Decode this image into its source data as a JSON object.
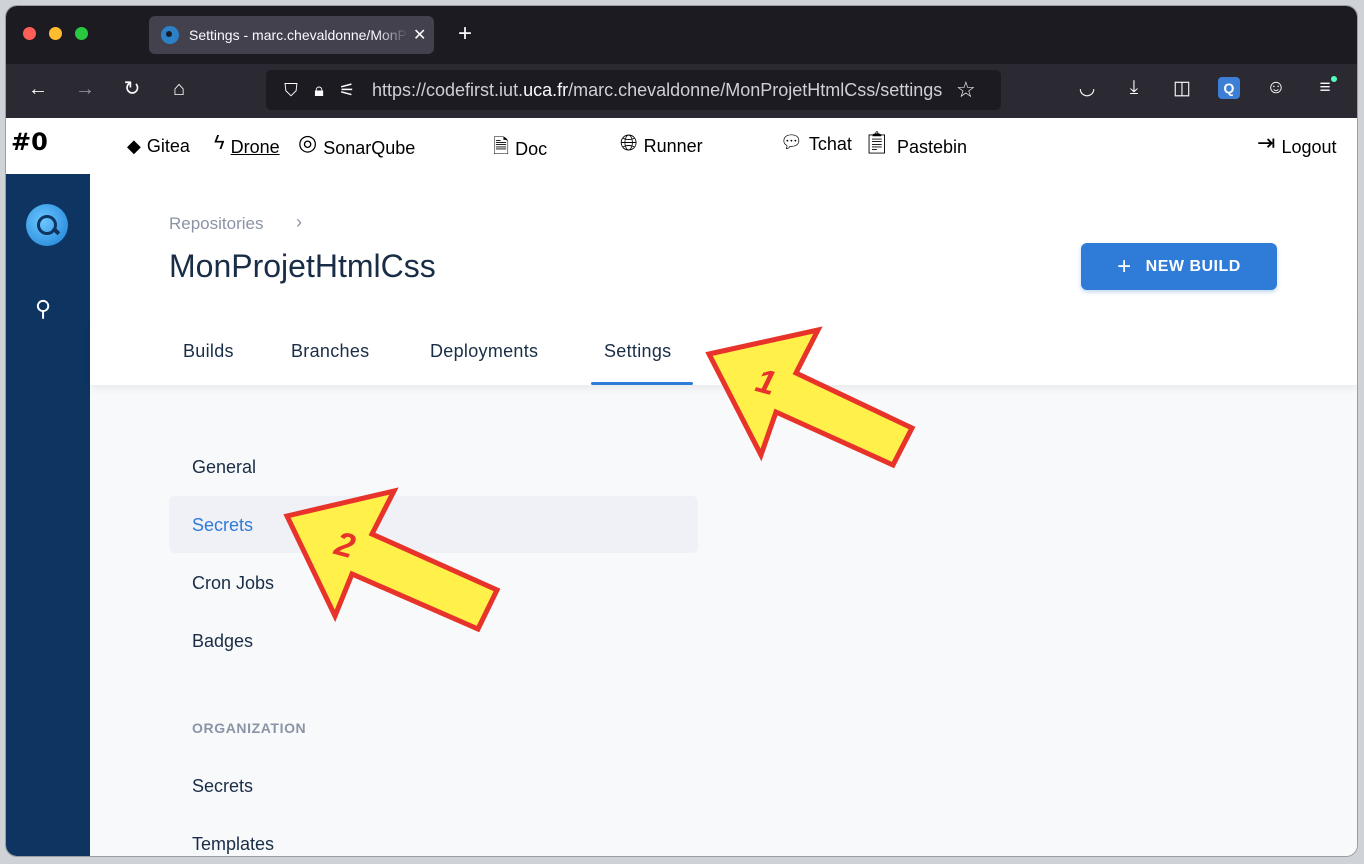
{
  "browser": {
    "tab_title": "Settings - marc.chevaldonne/MonProjetHtmlCss",
    "url_prefix": "https://codefirst.iut.",
    "url_domain": "uca.fr",
    "url_suffix": "/marc.chevaldonne/MonProjetHtmlCss/settings"
  },
  "site_header": {
    "logo": "#0",
    "links": [
      {
        "label": "Gitea",
        "icon": "git-icon"
      },
      {
        "label": "Drone",
        "icon": "lightning-icon"
      },
      {
        "label": "SonarQube",
        "icon": "sonarqube-icon"
      },
      {
        "label": "Doc",
        "icon": "doc-edit-icon"
      },
      {
        "label": "Runner",
        "icon": "globe-gear-icon"
      },
      {
        "label": "Tchat",
        "icon": "chat-icon"
      },
      {
        "label": "Pastebin",
        "icon": "clipboard-icon"
      },
      {
        "label": "Logout",
        "icon": "logout-icon"
      }
    ]
  },
  "page": {
    "breadcrumb": "Repositories",
    "repo_name": "MonProjetHtmlCss",
    "new_build_label": "NEW BUILD"
  },
  "tabs": [
    "Builds",
    "Branches",
    "Deployments",
    "Settings"
  ],
  "active_tab": "Settings",
  "settings_menu": {
    "items": [
      "General",
      "Secrets",
      "Cron Jobs",
      "Badges"
    ],
    "active": "Secrets",
    "section_label": "ORGANIZATION",
    "org_items": [
      "Secrets",
      "Templates"
    ]
  },
  "annotations": [
    "1",
    "2"
  ],
  "colors": {
    "sidebar": "#0e3461",
    "accent": "#2e7bd8",
    "arrow_fill": "#fff04a",
    "arrow_stroke": "#e8332b"
  }
}
